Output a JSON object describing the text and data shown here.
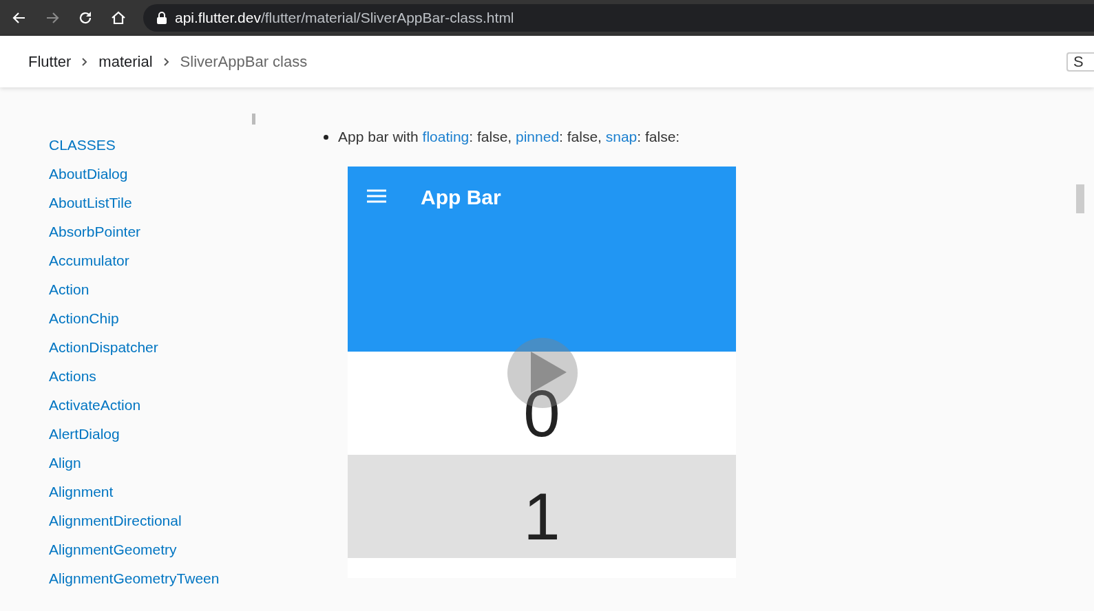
{
  "browser": {
    "url_host": "api.flutter.dev",
    "url_path": "/flutter/material/SliverAppBar-class.html"
  },
  "breadcrumbs": [
    {
      "label": "Flutter",
      "selected": false
    },
    {
      "label": "material",
      "selected": false
    },
    {
      "label": "SliverAppBar class",
      "selected": true
    }
  ],
  "search": {
    "placeholder": "S"
  },
  "sidebar": {
    "heading": "CLASSES",
    "items": [
      "AboutDialog",
      "AboutListTile",
      "AbsorbPointer",
      "Accumulator",
      "Action",
      "ActionChip",
      "ActionDispatcher",
      "Actions",
      "ActivateAction",
      "AlertDialog",
      "Align",
      "Alignment",
      "AlignmentDirectional",
      "AlignmentGeometry",
      "AlignmentGeometryTween"
    ]
  },
  "content": {
    "bullet": [
      {
        "kind": "text",
        "text": "App bar with "
      },
      {
        "kind": "link",
        "text": "floating"
      },
      {
        "kind": "text",
        "text": ": false, "
      },
      {
        "kind": "link",
        "text": "pinned"
      },
      {
        "kind": "text",
        "text": ": false, "
      },
      {
        "kind": "link",
        "text": "snap"
      },
      {
        "kind": "text",
        "text": ": false:"
      }
    ],
    "demo": {
      "app_bar_title": "App Bar",
      "rows": [
        {
          "label": "0",
          "shaded": false
        },
        {
          "label": "1",
          "shaded": true
        }
      ]
    }
  }
}
